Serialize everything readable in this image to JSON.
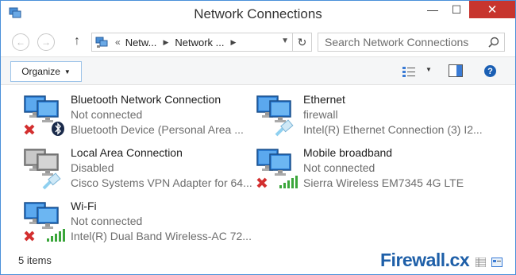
{
  "window": {
    "title": "Network Connections",
    "controls": {
      "minimize": "—",
      "maximize": "☐",
      "close": "✕"
    }
  },
  "nav": {
    "back_icon": "←",
    "forward_icon": "→",
    "up_icon": "↑",
    "breadcrumb": {
      "overflow": "«",
      "crumb1": "Netw...",
      "crumb2": "Network ..."
    },
    "refresh_icon": "↻"
  },
  "search": {
    "placeholder": "Search Network Connections"
  },
  "toolbar": {
    "organize_label": "Organize",
    "help_label": "?"
  },
  "connections": [
    {
      "name": "Bluetooth Network Connection",
      "status": "Not connected",
      "device": "Bluetooth Device (Personal Area ...",
      "icon": "bluetooth-network-icon",
      "badge": "disconnected-x"
    },
    {
      "name": "Ethernet",
      "status": "firewall",
      "device": "Intel(R) Ethernet Connection (3) I2...",
      "icon": "ethernet-network-icon",
      "badge": "none"
    },
    {
      "name": "Local Area Connection",
      "status": "Disabled",
      "device": "Cisco Systems VPN Adapter for 64...",
      "icon": "lan-disabled-icon",
      "badge": "none"
    },
    {
      "name": "Mobile broadband",
      "status": "Not connected",
      "device": "Sierra Wireless EM7345 4G LTE",
      "icon": "mobile-broadband-icon",
      "badge": "disconnected-x"
    },
    {
      "name": "Wi-Fi",
      "status": "Not connected",
      "device": "Intel(R) Dual Band Wireless-AC 72...",
      "icon": "wifi-network-icon",
      "badge": "disconnected-x"
    }
  ],
  "status": {
    "item_count": "5 items"
  },
  "watermark": {
    "text": "Firewall.cx"
  },
  "colors": {
    "accent": "#1a5fb4",
    "close": "#c7352e",
    "status_text": "#6d6d6d",
    "error_x": "#d32f2f",
    "signal": "#3aa63a"
  }
}
